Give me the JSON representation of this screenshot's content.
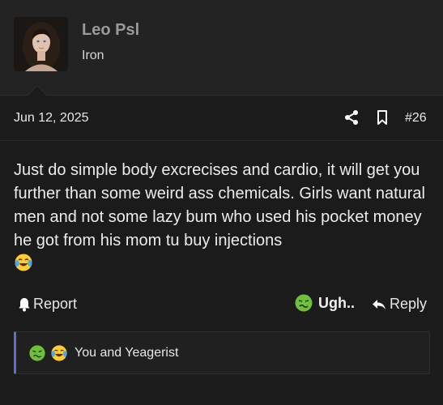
{
  "user": {
    "name": "Leo Psl",
    "title": "Iron"
  },
  "post": {
    "date": "Jun 12, 2025",
    "number": "#26",
    "text": "Just do simple body excrecises and cardio, it will get you further than some weird ass chemicals. Girls want natural men and not some lazy bum who used his pocket money he got from his mom tu buy injections"
  },
  "actions": {
    "report_label": "Report",
    "reaction_label": "Ugh..",
    "reply_label": "Reply"
  },
  "reactions": {
    "summary": "You and Yeagerist"
  },
  "icons": {
    "share": "share-icon",
    "bookmark": "bookmark-icon",
    "bell": "bell-icon",
    "reply": "reply-arrow-icon",
    "sick_face": "sick-face-emoji",
    "laugh_cry": "laughing-crying-emoji"
  },
  "colors": {
    "background": "#1b1b1b",
    "header_bg": "#232323",
    "username": "#9a9a9a",
    "reaction_accent": "#5f6fcf",
    "sick_green": "#6fbf3b"
  }
}
